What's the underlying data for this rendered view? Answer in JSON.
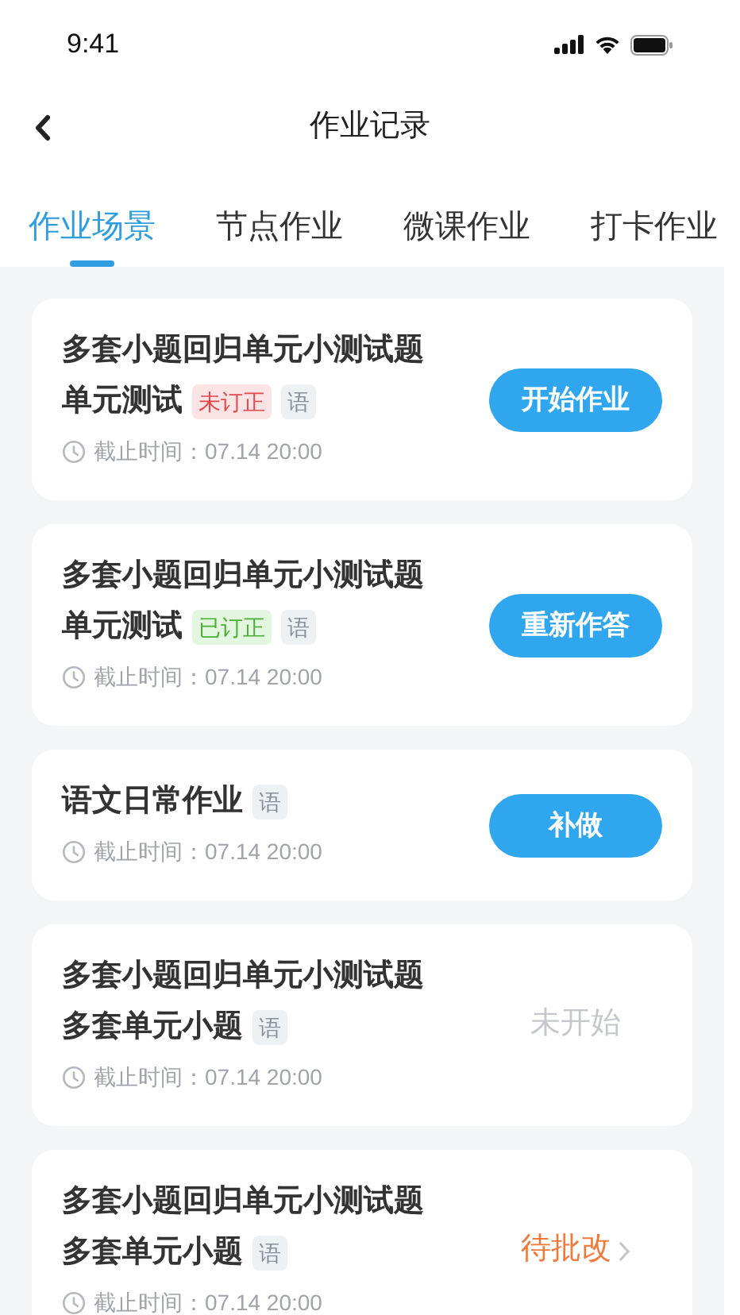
{
  "status_bar": {
    "time": "9:41"
  },
  "nav": {
    "title": "作业记录"
  },
  "tabs": [
    {
      "label": "作业场景",
      "selected": true
    },
    {
      "label": "节点作业",
      "selected": false
    },
    {
      "label": "微课作业",
      "selected": false
    },
    {
      "label": "打卡作业",
      "selected": false
    }
  ],
  "cards": [
    {
      "title_lines": [
        "多套小题回归单元小测试题",
        "单元测试"
      ],
      "tags": [
        {
          "kind": "uncorrected",
          "label": "未订正"
        },
        {
          "kind": "subject",
          "label": "语"
        }
      ],
      "deadline": "截止时间：07.14 20:00",
      "action": {
        "kind": "button",
        "label": "开始作业"
      }
    },
    {
      "title_lines": [
        "多套小题回归单元小测试题",
        "单元测试"
      ],
      "tags": [
        {
          "kind": "corrected",
          "label": "已订正"
        },
        {
          "kind": "subject",
          "label": "语"
        }
      ],
      "deadline": "截止时间：07.14 20:00",
      "action": {
        "kind": "button",
        "label": "重新作答"
      }
    },
    {
      "title_lines": [
        "语文日常作业"
      ],
      "tags": [
        {
          "kind": "subject",
          "label": "语"
        }
      ],
      "deadline": "截止时间：07.14 20:00",
      "action": {
        "kind": "button",
        "label": "补做"
      }
    },
    {
      "title_lines": [
        "多套小题回归单元小测试题",
        "多套单元小题"
      ],
      "tags": [
        {
          "kind": "subject",
          "label": "语"
        }
      ],
      "deadline": "截止时间：07.14 20:00",
      "action": {
        "kind": "status",
        "label": "未开始"
      }
    },
    {
      "title_lines": [
        "多套小题回归单元小测试题",
        "多套单元小题"
      ],
      "tags": [
        {
          "kind": "subject",
          "label": "语"
        }
      ],
      "deadline": "截止时间：07.14 20:00",
      "action": {
        "kind": "link",
        "label": "待批改"
      }
    }
  ]
}
